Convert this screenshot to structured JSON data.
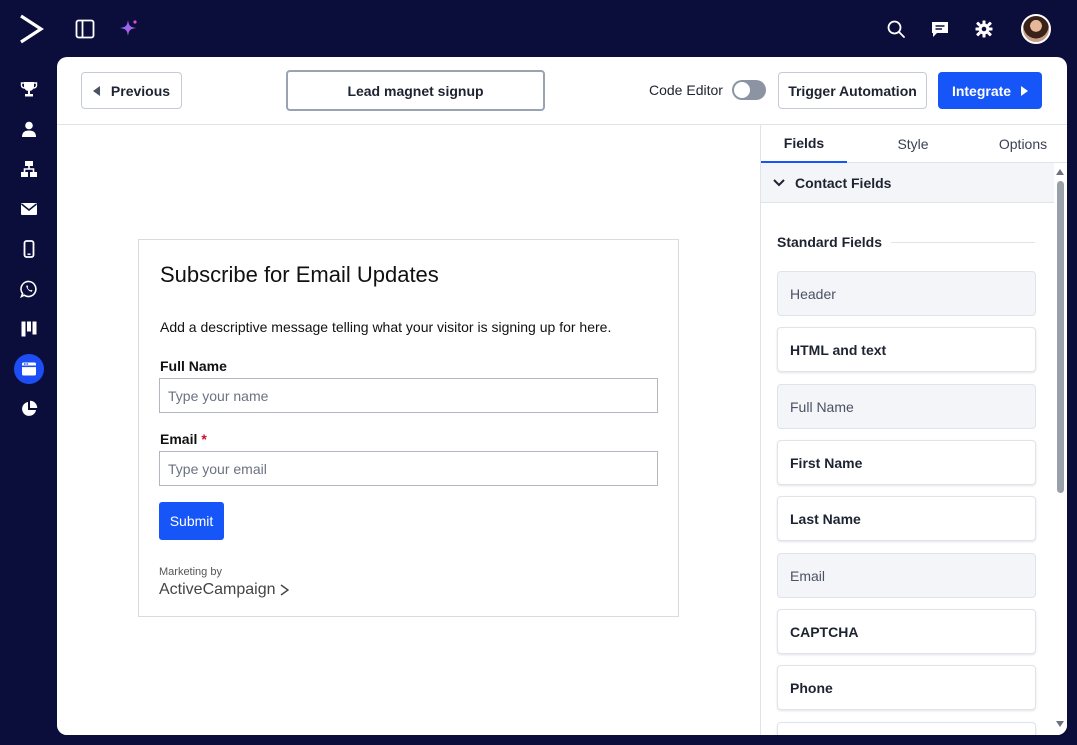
{
  "toolbar": {
    "previous_label": "Previous",
    "form_name": "Lead magnet signup",
    "code_editor_label": "Code Editor",
    "trigger_label": "Trigger Automation",
    "integrate_label": "Integrate"
  },
  "nav": {
    "items": [
      {
        "icon": "trophy-icon"
      },
      {
        "icon": "user-icon"
      },
      {
        "icon": "sitemap-icon"
      },
      {
        "icon": "envelope-icon"
      },
      {
        "icon": "mobile-icon"
      },
      {
        "icon": "whatsapp-icon"
      },
      {
        "icon": "kanban-icon"
      },
      {
        "icon": "forms-icon",
        "active": true
      },
      {
        "icon": "pie-chart-icon"
      }
    ]
  },
  "form": {
    "title": "Subscribe for Email Updates",
    "description": "Add a descriptive message telling what your visitor is signing up for here.",
    "full_name_label": "Full Name",
    "full_name_placeholder": "Type your name",
    "email_label": "Email",
    "email_required_mark": "*",
    "email_placeholder": "Type your email",
    "submit_label": "Submit",
    "marketing_by": "Marketing by",
    "brand": "ActiveCampaign"
  },
  "panel": {
    "tabs": [
      "Fields",
      "Style",
      "Options"
    ],
    "section_title": "Contact Fields",
    "standard_title": "Standard Fields",
    "fields": [
      {
        "label": "Header",
        "muted": true
      },
      {
        "label": "HTML and text",
        "muted": false
      },
      {
        "label": "Full Name",
        "muted": true
      },
      {
        "label": "First Name",
        "muted": false
      },
      {
        "label": "Last Name",
        "muted": false
      },
      {
        "label": "Email",
        "muted": true
      },
      {
        "label": "CAPTCHA",
        "muted": false
      },
      {
        "label": "Phone",
        "muted": false
      },
      {
        "label": "",
        "muted": false
      }
    ]
  },
  "colors": {
    "background": "#0b0d3a",
    "accent": "#1655f7",
    "required": "#c8102e"
  }
}
